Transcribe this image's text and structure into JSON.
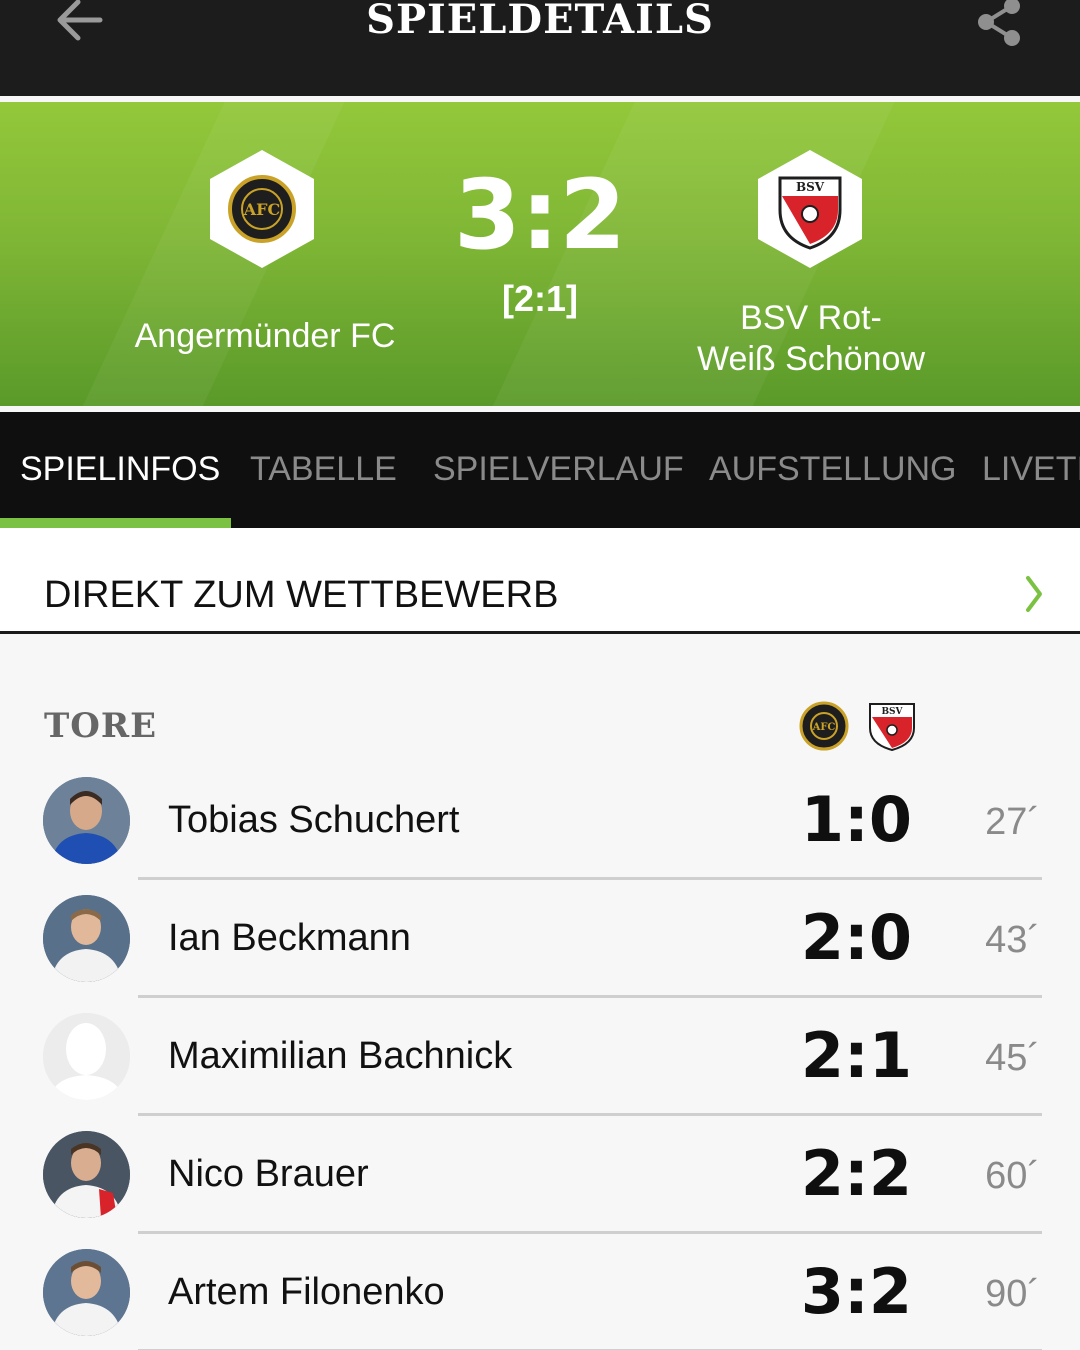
{
  "header": {
    "title": "SPIELDETAILS",
    "back_icon": "arrow-left-icon",
    "share_icon": "share-icon"
  },
  "match": {
    "home_team": "Angermünder FC",
    "away_team_line1": "BSV Rot-",
    "away_team_line2": "Weiß Schönow",
    "score": "3:2",
    "halftime": "[2:1]"
  },
  "tabs": [
    {
      "label": "SPIELINFOS",
      "active": true
    },
    {
      "label": "TABELLE",
      "active": false
    },
    {
      "label": "SPIELVERLAUF",
      "active": false
    },
    {
      "label": "AUFSTELLUNG",
      "active": false
    },
    {
      "label": "LIVETI",
      "active": false
    }
  ],
  "competition": {
    "label": "DIREKT ZUM WETTBEWERB",
    "chevron_icon": "chevron-right-icon"
  },
  "goals": {
    "title": "TORE",
    "items": [
      {
        "player": "Tobias Schuchert",
        "score": "1:0",
        "minute": "27´"
      },
      {
        "player": "Ian Beckmann",
        "score": "2:0",
        "minute": "43´"
      },
      {
        "player": "Maximilian Bachnick",
        "score": "2:1",
        "minute": "45´"
      },
      {
        "player": "Nico Brauer",
        "score": "2:2",
        "minute": "60´"
      },
      {
        "player": "Artem Filonenko",
        "score": "3:2",
        "minute": "90´"
      }
    ]
  },
  "colors": {
    "accent_green": "#7cc242",
    "header_dark": "#1c1c1c",
    "tab_bar": "#0f0f0f",
    "away_red": "#d8232a"
  }
}
